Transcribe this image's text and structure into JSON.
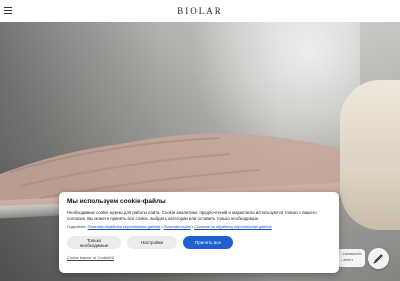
{
  "header": {
    "brand": "BIOLAR"
  },
  "cookie_banner": {
    "title": "Мы используем cookie-файлы",
    "text": "Необходимые cookie нужны для работы сайта. Cookie аналитики, предпочтений и маркетинга используются только с вашего согласия. Вы можете принять все cookie, выбрать категории или оставить только необходимые.",
    "details_label": "Подробнее:",
    "links": [
      "Политика обработки персональных данных",
      "Политика cookie",
      "Согласие на обработку персональных данных"
    ],
    "buttons": {
      "necessary_only": "Только необходимые",
      "settings": "Настройки",
      "accept_all": "Принять все"
    },
    "powered_by": "Cookie banner от CookieKit",
    "accent_color": "#1f5fd1"
  },
  "chat": {
    "bubble_text": "...напишите ...агент"
  },
  "icons": {
    "menu": "hamburger-menu-icon",
    "chat": "chat-icon"
  }
}
